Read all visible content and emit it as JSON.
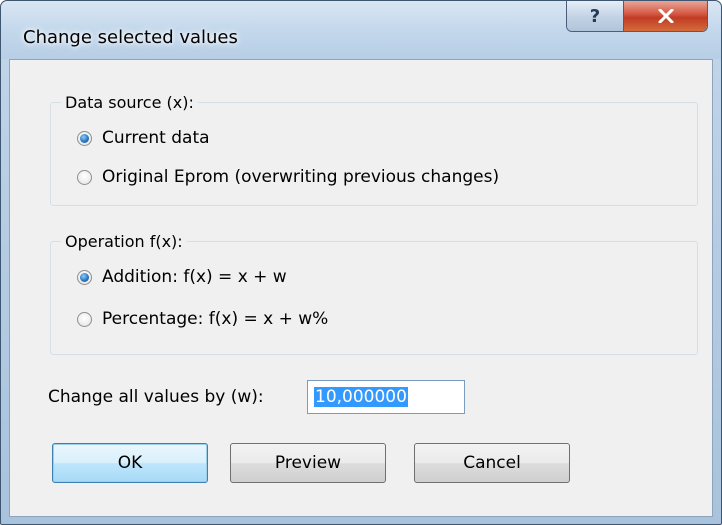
{
  "window": {
    "title": "Change selected values",
    "help_label": "?",
    "close_label": "x"
  },
  "data_source": {
    "legend": "Data source (x):",
    "options": [
      {
        "label": "Current data",
        "checked": true
      },
      {
        "label": "Original Eprom (overwriting previous changes)",
        "checked": false
      }
    ]
  },
  "operation": {
    "legend": "Operation f(x):",
    "options": [
      {
        "label": "Addition: f(x) = x + w",
        "checked": true
      },
      {
        "label": "Percentage: f(x) = x + w%",
        "checked": false
      }
    ]
  },
  "change": {
    "label": "Change all values by (w):",
    "value": "10,000000"
  },
  "buttons": {
    "ok": "OK",
    "preview": "Preview",
    "cancel": "Cancel"
  },
  "colors": {
    "selection": "#3399ff",
    "close_button": "#c03c24",
    "title_bar": "#c4d8ec"
  }
}
